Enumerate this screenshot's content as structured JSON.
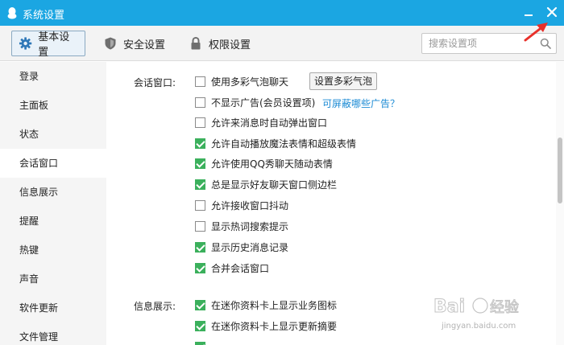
{
  "window": {
    "title": "系统设置"
  },
  "toolbar": {
    "tabs": [
      {
        "label": "基本设置",
        "icon": "gear-icon"
      },
      {
        "label": "安全设置",
        "icon": "shield-icon"
      },
      {
        "label": "权限设置",
        "icon": "lock-icon"
      }
    ]
  },
  "search": {
    "placeholder": "搜索设置项",
    "value": ""
  },
  "sidebar": {
    "items": [
      {
        "label": "登录"
      },
      {
        "label": "主面板"
      },
      {
        "label": "状态"
      },
      {
        "label": "会话窗口"
      },
      {
        "label": "信息展示"
      },
      {
        "label": "提醒"
      },
      {
        "label": "热键"
      },
      {
        "label": "声音"
      },
      {
        "label": "软件更新"
      },
      {
        "label": "文件管理"
      }
    ],
    "active": "会话窗口"
  },
  "sections": {
    "chat_window": {
      "label": "会话窗口:",
      "bubble_button": "设置多彩气泡",
      "ad_link": "可屏蔽哪些广告？",
      "options": [
        {
          "label": "使用多彩气泡聊天",
          "checked": false
        },
        {
          "label": "不显示广告(会员设置项)",
          "checked": false
        },
        {
          "label": "允许来消息时自动弹出窗口",
          "checked": false
        },
        {
          "label": "允许自动播放魔法表情和超级表情",
          "checked": true
        },
        {
          "label": "允许使用QQ秀聊天随动表情",
          "checked": true
        },
        {
          "label": "总是显示好友聊天窗口侧边栏",
          "checked": true
        },
        {
          "label": "允许接收窗口抖动",
          "checked": false
        },
        {
          "label": "显示热词搜索提示",
          "checked": false
        },
        {
          "label": "显示历史消息记录",
          "checked": true
        },
        {
          "label": "合并会话窗口",
          "checked": true
        }
      ]
    },
    "info_display": {
      "label": "信息展示:",
      "options": [
        {
          "label": "在迷你资料卡上显示业务图标",
          "checked": true
        },
        {
          "label": "在迷你资料卡上显示更新摘要",
          "checked": true
        }
      ]
    }
  },
  "watermark": {
    "text": "jingyan.baidu.com"
  },
  "colors": {
    "titlebar": "#1ba6e2",
    "check": "#3bb05c",
    "link": "#1a8ad4",
    "annotation_arrow": "#e8302a"
  }
}
